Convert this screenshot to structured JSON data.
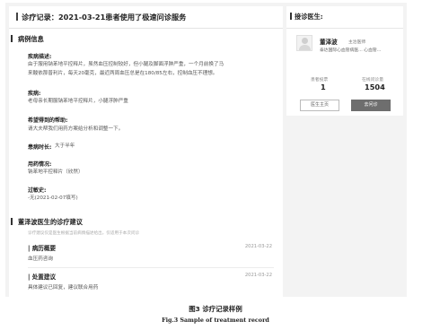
{
  "record": {
    "title": "诊疗记录：2021-03-21患者使用了极速问诊服务"
  },
  "case_info": {
    "heading": "病例信息",
    "description_label": "疾病描述:",
    "description_line1": "由于服用钠苯地平控释片，虽然血压控制较好，但小腿及脚面浮肿严重，一个月前换了马",
    "description_line2": "来酸依那普利片，每天20毫克，最近两周血压总是在180/85左右，控制血压不理想。",
    "disease_label": "疾病:",
    "disease_value": "老母亲长期服钠苯地平控释片，小腿浮肿严重",
    "help_label": "希望得到的帮助:",
    "help_value": "请大夫帮我们用药方案给分析和调整一下。",
    "duration_label": "患病时长:",
    "duration_value": "大于半年",
    "medication_label": "用药情况:",
    "medication_value": "钠苯地平控释片（欣然）",
    "allergy_label": "过敏史:",
    "allergy_value": "-无(2021-02-07填写)"
  },
  "advice": {
    "heading": "董泽波医生的诊疗建议",
    "note": "诊疗建议仅是医生根据当前病情描述给出，仅适用于本次问诊",
    "items": [
      {
        "title": "病历概要",
        "date": "2021-03-22",
        "content": "血压药咨询"
      },
      {
        "title": "处置建议",
        "date": "2021-03-22",
        "content": "具体建议已回复，建议联合用药"
      }
    ]
  },
  "doctor": {
    "panel_title": "接诊医生:",
    "avatar_icon": "doctor-avatar-icon",
    "name": "董泽波",
    "title": "主治医师",
    "hospital": "泰达国际心血管病医... 心血管...",
    "vote_label": "患者投票",
    "vote_value": "1",
    "consult_label": "在线问诊量",
    "consult_value": "1504",
    "home_button": "医生主页",
    "consult_button": "去问诊"
  },
  "caption": {
    "cn": "图3   诊疗记录样例",
    "en": "Fig.3   Sample of treatment record"
  }
}
